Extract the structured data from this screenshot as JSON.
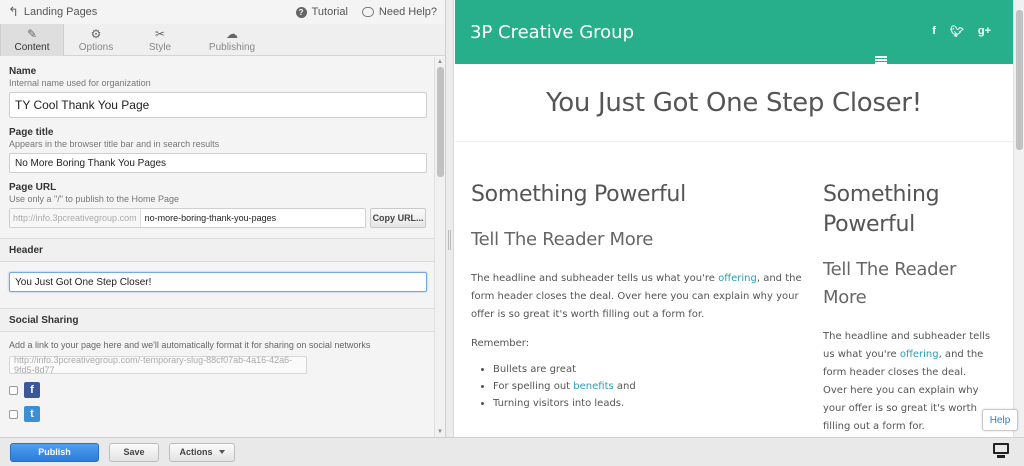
{
  "topbar": {
    "back_label": "Landing Pages",
    "tutorial_label": "Tutorial",
    "help_label": "Need Help?"
  },
  "tabs": [
    {
      "label": "Content",
      "icon": "pencil-icon",
      "active": true
    },
    {
      "label": "Options",
      "icon": "gear-icon",
      "active": false
    },
    {
      "label": "Style",
      "icon": "scissors-icon",
      "active": false
    },
    {
      "label": "Publishing",
      "icon": "cloud-upload-icon",
      "active": false
    }
  ],
  "form": {
    "name": {
      "label": "Name",
      "help": "Internal name used for organization",
      "value": "TY Cool Thank You Page"
    },
    "page_title": {
      "label": "Page title",
      "help": "Appears in the browser title bar and in search results",
      "value": "No More Boring Thank You Pages"
    },
    "page_url": {
      "label": "Page URL",
      "help": "Use only a \"/\" to publish to the Home Page",
      "prefix": "http://info.3pcreativegroup.com",
      "slug": "no-more-boring-thank-you-pages",
      "copy_label": "Copy URL..."
    },
    "header": {
      "section_label": "Header",
      "value": "You Just Got One Step Closer!"
    },
    "social": {
      "section_label": "Social Sharing",
      "help": "Add a link to your page here and we'll automatically format it for sharing on social networks",
      "url_placeholder": "http://info.3pcreativegroup.com/-temporary-slug-88cf07ab-4a16-42a6-9fd5-8d77"
    }
  },
  "preview": {
    "brand": "3P Creative Group",
    "social_icons": [
      "f",
      "twitter-icon",
      "g+"
    ],
    "hero_title": "You Just Got One Step Closer!",
    "left": {
      "heading": "Something Powerful",
      "subheading": "Tell The Reader More",
      "para_before": "The headline and subheader tells us what you're ",
      "para_link": "offering",
      "para_after": ", and the form header closes the deal. Over here you can explain why your offer is so great it's worth filling out a form for.",
      "remember": "Remember:",
      "bullets": {
        "b1": "Bullets are great",
        "b2_before": "For spelling out ",
        "b2_link": "benefits",
        "b2_after": " and",
        "b3": "Turning visitors into leads."
      }
    },
    "right": {
      "heading_l1": "Something",
      "heading_l2": "Powerful",
      "subheading_l1": "Tell The Reader",
      "subheading_l2": "More",
      "para_before": "The headline and subheader tells us what you're ",
      "para_link": "offering",
      "para_after": ", and the form header closes the deal. Over here you can explain why your offer is so great it's worth filling out a form for."
    },
    "help_label": "Help"
  },
  "bottombar": {
    "publish_label": "Publish",
    "save_label": "Save",
    "actions_label": "Actions"
  },
  "colors": {
    "brand_green": "#27ae8a",
    "publish_blue": "#2c7ddb",
    "link": "#2a9db5"
  }
}
